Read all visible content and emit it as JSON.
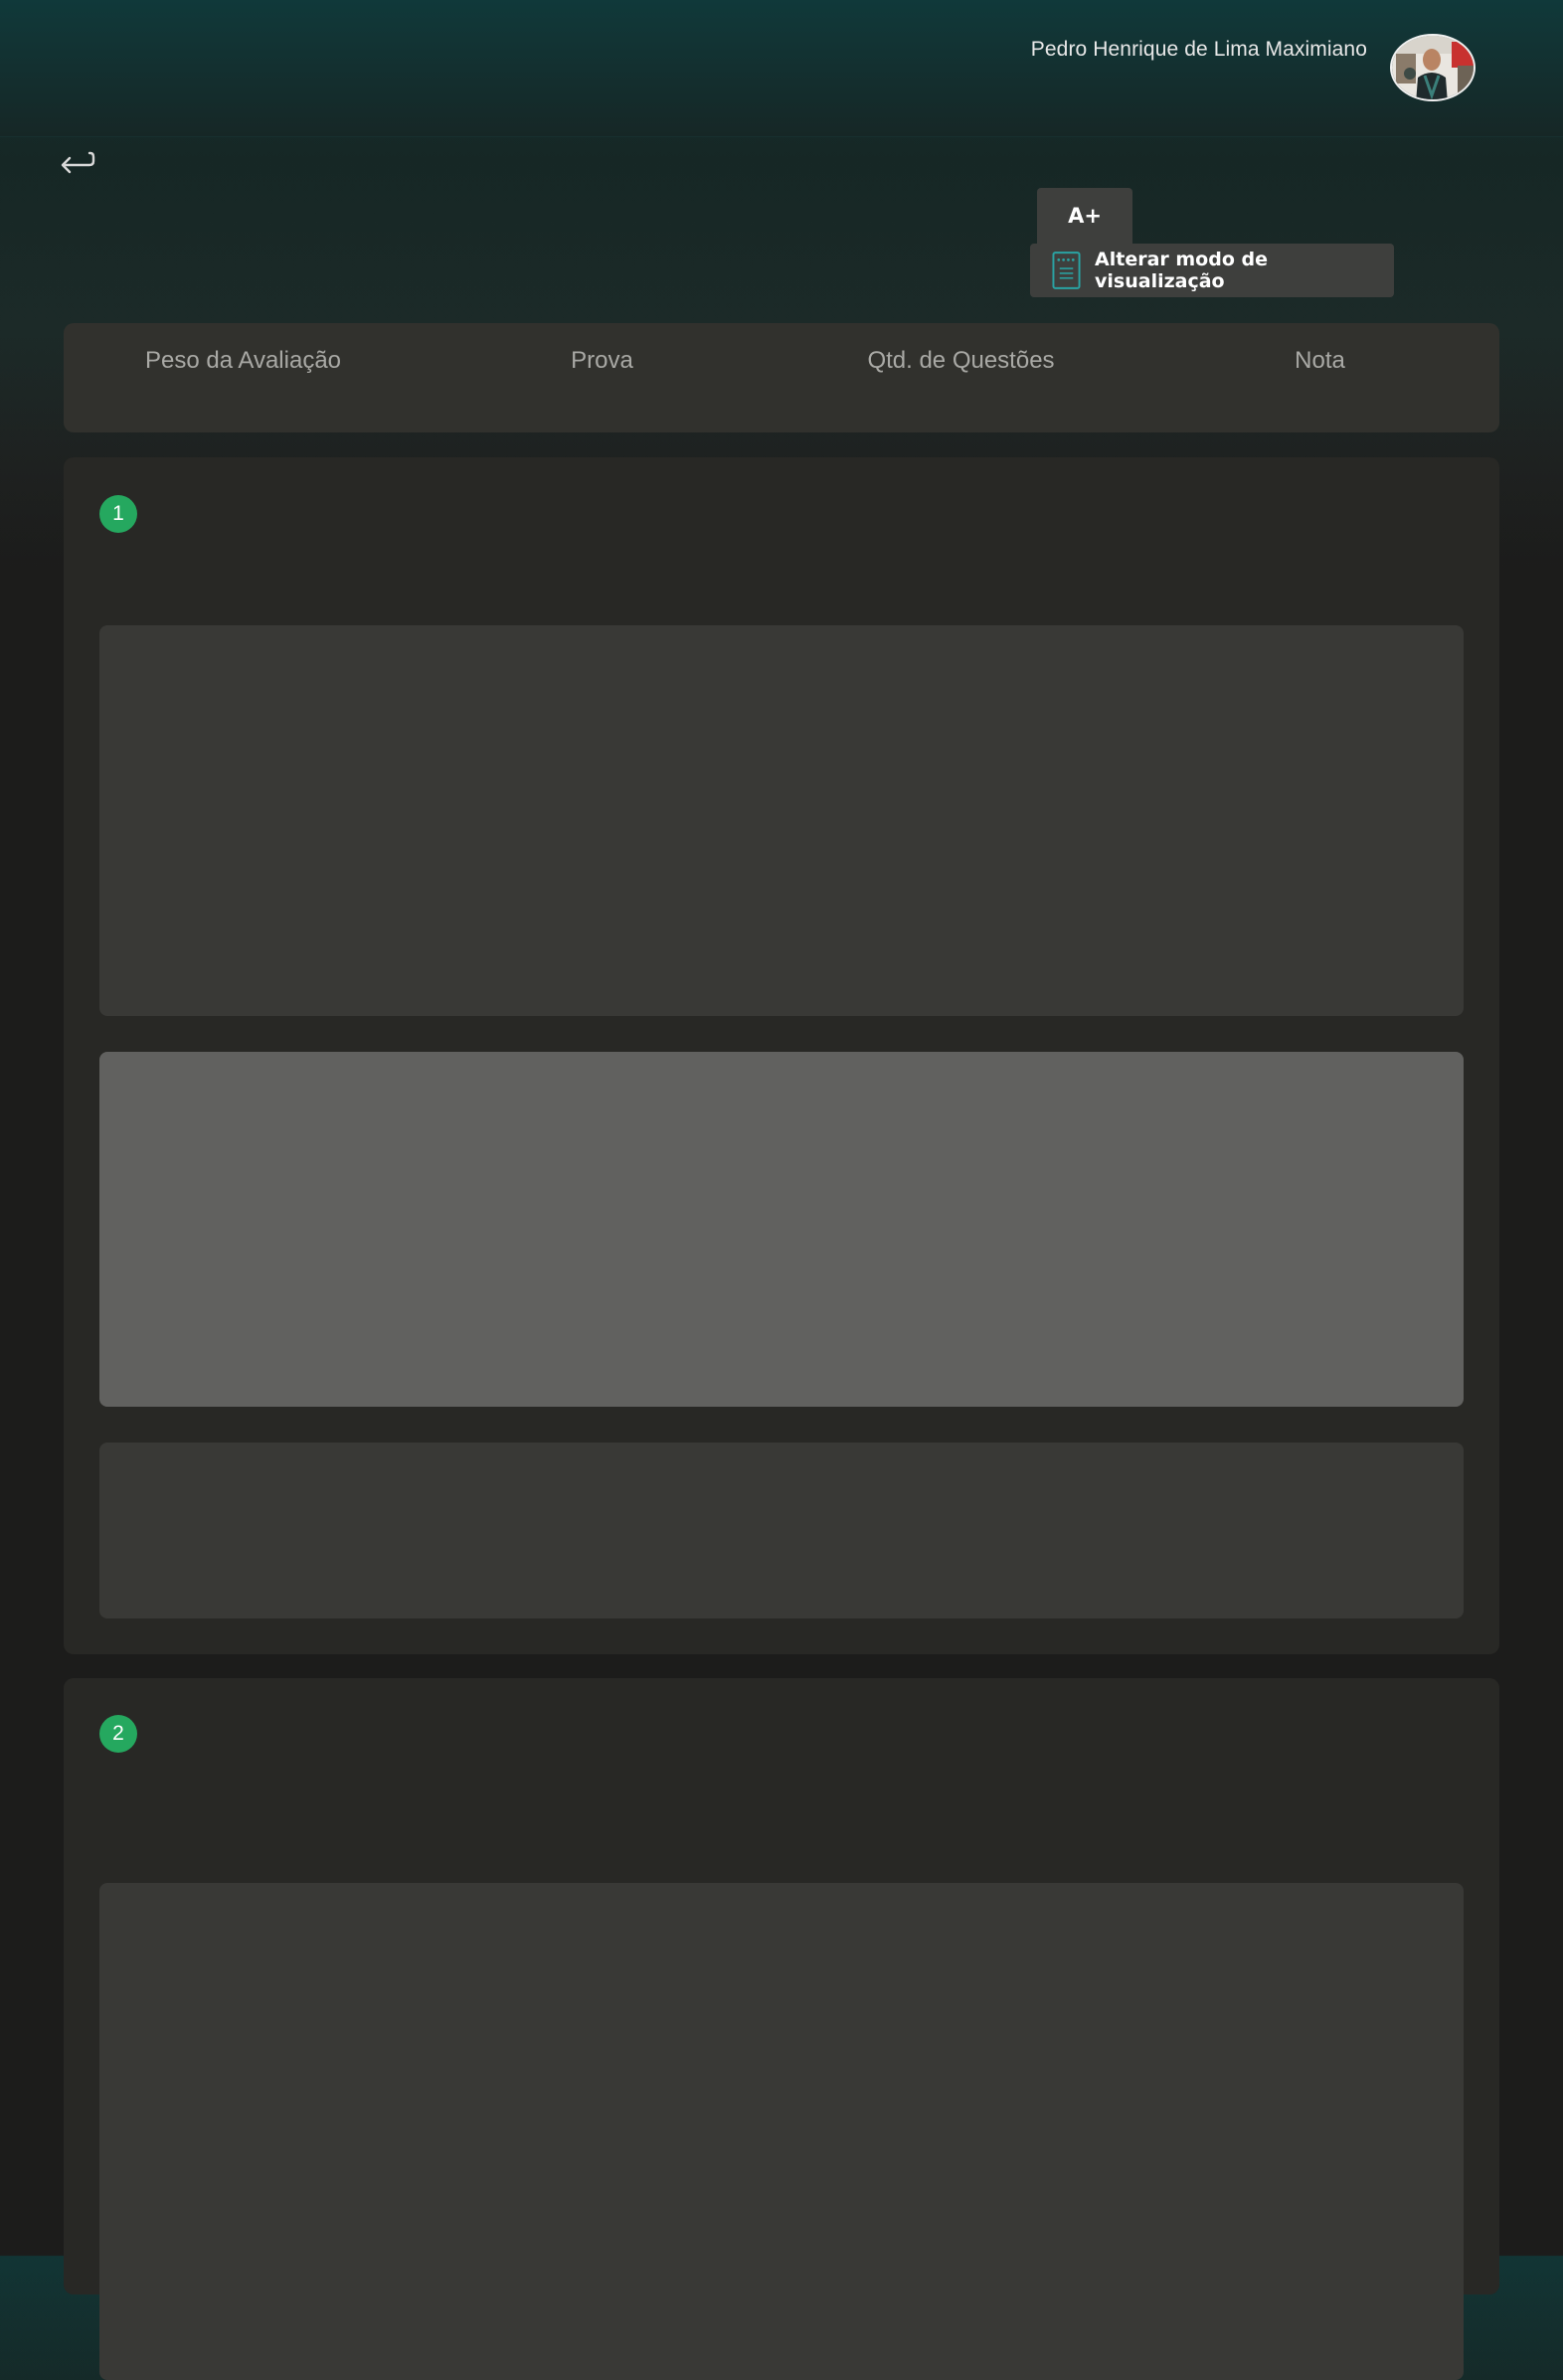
{
  "header": {
    "user_name": "Pedro Henrique de Lima Maximiano"
  },
  "toolbar": {
    "font_increase_label": "A+",
    "view_mode_label": "Alterar modo de visualização"
  },
  "summary": {
    "columns": [
      "Peso da Avaliação",
      "Prova",
      "Qtd. de Questões",
      "Nota"
    ]
  },
  "questions": [
    {
      "number": "1"
    },
    {
      "number": "2"
    }
  ],
  "colors": {
    "accent_green": "#25a85f",
    "header_teal": "#10393a",
    "card": "#282825",
    "panel": "#393936",
    "option_highlight": "#61615f"
  },
  "icons": {
    "back": "return-arrow-icon",
    "view_mode": "document-icon",
    "avatar": "user-avatar"
  }
}
